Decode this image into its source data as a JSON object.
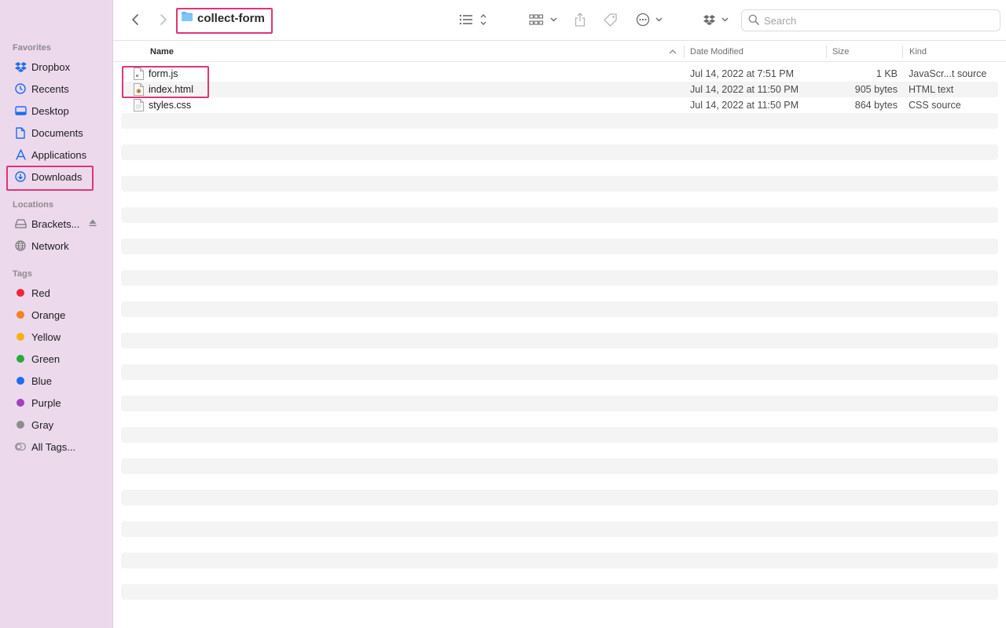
{
  "sidebar": {
    "favorites_title": "Favorites",
    "favorites": [
      {
        "label": "Dropbox",
        "icon": "dropbox-icon"
      },
      {
        "label": "Recents",
        "icon": "clock-icon"
      },
      {
        "label": "Desktop",
        "icon": "desktop-icon"
      },
      {
        "label": "Documents",
        "icon": "document-icon"
      },
      {
        "label": "Applications",
        "icon": "applications-icon"
      },
      {
        "label": "Downloads",
        "icon": "download-icon"
      }
    ],
    "locations_title": "Locations",
    "locations": [
      {
        "label": "Brackets...",
        "icon": "drive-icon"
      },
      {
        "label": "Network",
        "icon": "globe-icon"
      }
    ],
    "tags_title": "Tags",
    "tags": [
      {
        "label": "Red",
        "color": "#f0263a"
      },
      {
        "label": "Orange",
        "color": "#f7821b"
      },
      {
        "label": "Yellow",
        "color": "#f5b20e"
      },
      {
        "label": "Green",
        "color": "#29a93c"
      },
      {
        "label": "Blue",
        "color": "#1a6ef0"
      },
      {
        "label": "Purple",
        "color": "#a33fc4"
      },
      {
        "label": "Gray",
        "color": "#8c8c8c"
      },
      {
        "label": "All Tags...",
        "color": ""
      }
    ]
  },
  "toolbar": {
    "folder_title": "collect-form",
    "search_placeholder": "Search"
  },
  "columns": {
    "name": "Name",
    "date": "Date Modified",
    "size": "Size",
    "kind": "Kind"
  },
  "files": [
    {
      "name": "form.js",
      "date": "Jul 14, 2022 at 7:51 PM",
      "size": "1 KB",
      "kind": "JavaScr...t source",
      "icon": "js-file-icon"
    },
    {
      "name": "index.html",
      "date": "Jul 14, 2022 at 11:50 PM",
      "size": "905 bytes",
      "kind": "HTML text",
      "icon": "html-file-icon"
    },
    {
      "name": "styles.css",
      "date": "Jul 14, 2022 at 11:50 PM",
      "size": "864 bytes",
      "kind": "CSS source",
      "icon": "css-file-icon"
    }
  ],
  "colors": {
    "sidebar_bg": "#ecd9ec",
    "highlight": "#e0347a",
    "accent": "#1a6ef0"
  }
}
